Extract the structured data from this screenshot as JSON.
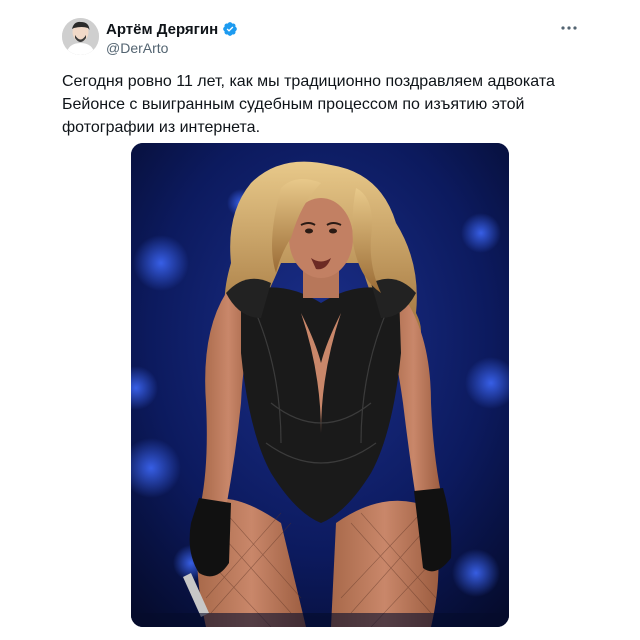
{
  "author": {
    "display_name": "Артём Дерягин",
    "handle": "@DerArto",
    "verified": true,
    "avatar_icon": "person-avatar",
    "verified_icon": "verified-badge-icon",
    "verified_color": "#1d9bf0"
  },
  "menu": {
    "icon": "more-horizontal-icon"
  },
  "tweet": {
    "text": "Сегодня ровно 11 лет, как мы традиционно поздравляем адвоката\nБейонсе с выигранным судебным процессом по изъятию этой\nфотографии из интернета."
  },
  "media": {
    "kind": "photo",
    "subject": "performer on stage"
  },
  "colors": {
    "text_primary": "#0f1419",
    "text_secondary": "#536471",
    "background": "#ffffff",
    "photo_background": "#0a1440"
  }
}
